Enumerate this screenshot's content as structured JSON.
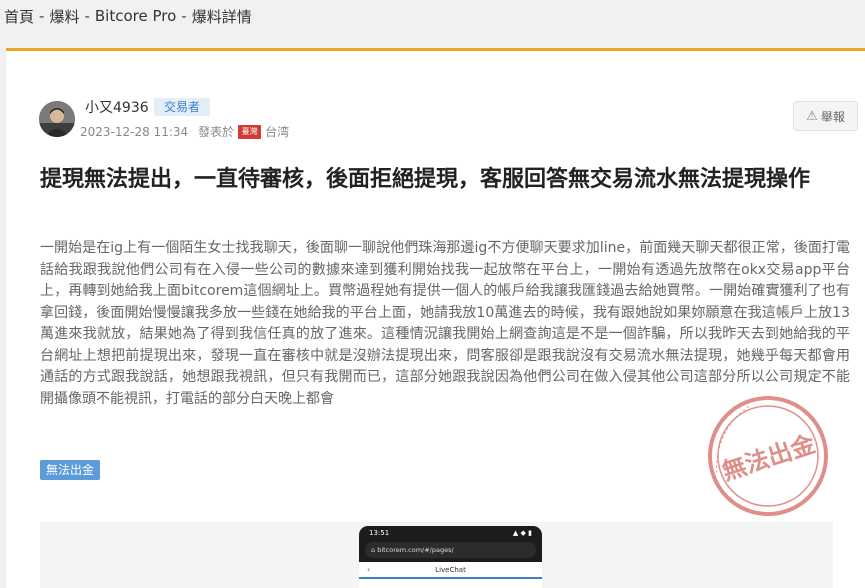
{
  "breadcrumb": {
    "items": [
      "首頁",
      "爆料",
      "Bitcore Pro",
      "爆料詳情"
    ],
    "separator": "-"
  },
  "post": {
    "author": "小又4936",
    "role_badge": "交易者",
    "datetime": "2023-12-28 11:34",
    "published_in_label": "發表於",
    "flag_text": "臺灣",
    "location": "台湾",
    "report_label": "舉報",
    "title": "提現無法提出，一直待審核，後面拒絕提現，客服回答無交易流水無法提現操作",
    "body": "一開始是在ig上有一個陌生女士找我聊天，後面聊一聊說他們珠海那邊ig不方便聊天要求加line，前面幾天聊天都很正常，後面打電話給我跟我說他們公司有在入侵一些公司的數據來達到獲利開始找我一起放幣在平台上，一開始有透過先放幣在okx交易app平台上，再轉到她給我上面bitcorem這個網址上。買幣過程她有提供一個人的帳戶給我讓我匯錢過去給她買幣。一開始確實獲利了也有拿回錢，後面開始慢慢讓我多放一些錢在她給我的平台上面，她請我放10萬進去的時候，我有跟她說如果妳願意在我這帳戶上放13萬進來我就放，結果她為了得到我信任真的放了進來。這種情況讓我開始上網查詢這是不是一個詐騙，所以我昨天去到她給我的平台網址上想把前提現出來，發現一直在審核中就是沒辦法提現出來，問客服卻是跟我說沒有交易流水無法提現，她幾乎每天都會用通話的方式跟我說話，她想跟我視訊，但只有我開而已，這部分她跟我說因為他們公司在做入侵其他公司這部分所以公司規定不能開攝像頭不能視訊，打電話的部分白天晚上都會",
    "stamp_text": "無法出金",
    "tag": "無法出金"
  },
  "screenshot": {
    "time": "13:51",
    "url": "bitcorem.com/#/pages/",
    "chat_title": "LiveChat"
  },
  "colors": {
    "accent_border": "#e6a92a",
    "badge_bg": "#e4eef9",
    "badge_text": "#3c7fc9",
    "tag_bg": "#5b9bd9",
    "stamp_red": "#c8332b"
  }
}
